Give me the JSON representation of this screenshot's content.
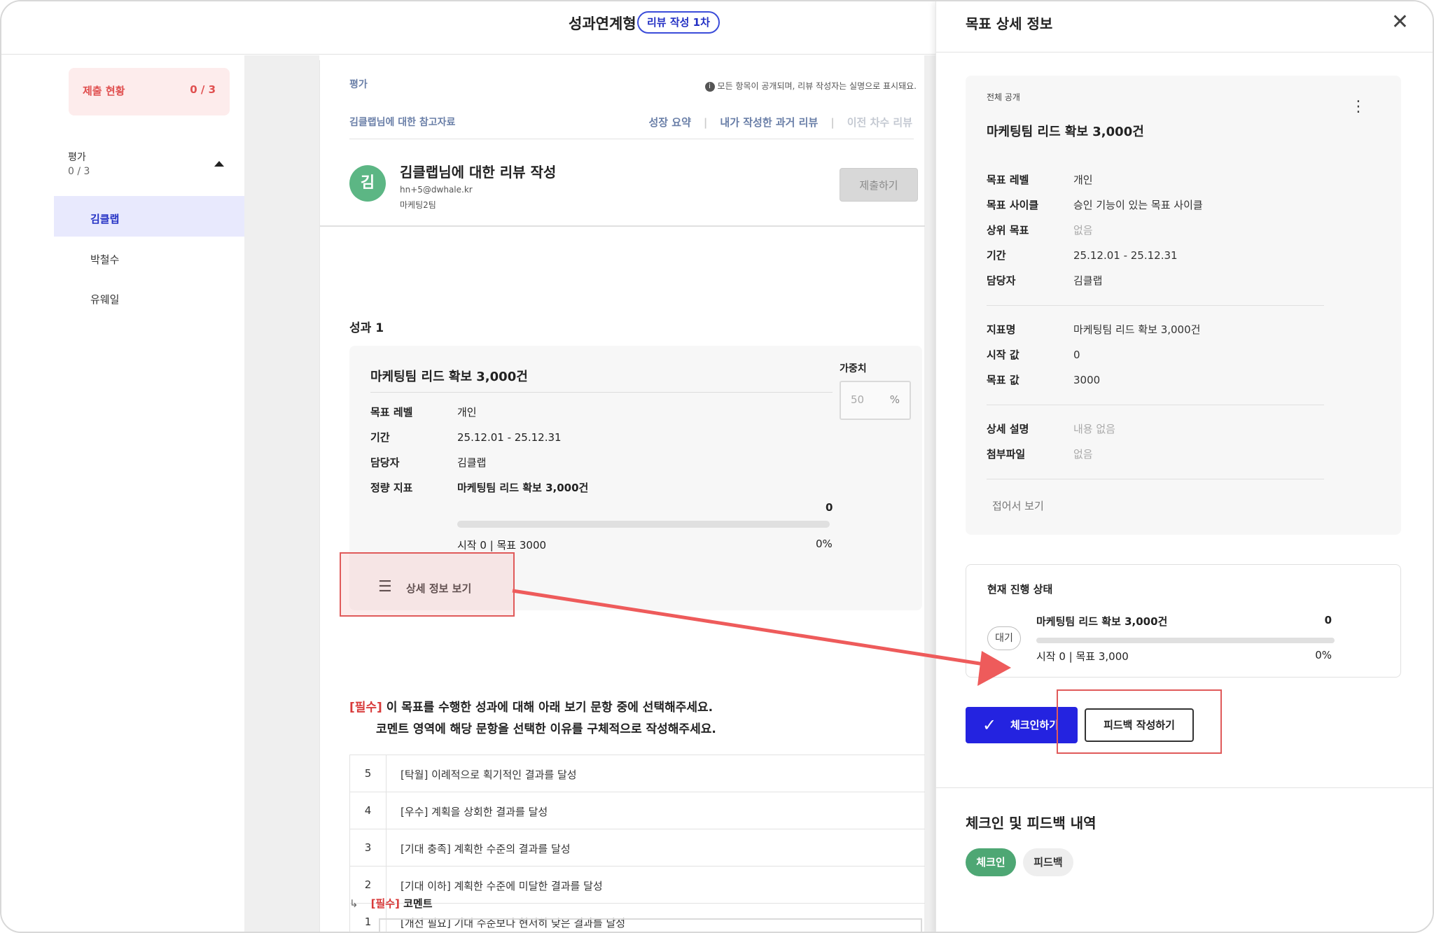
{
  "header": {
    "title": "성과연계형",
    "badge": "리뷰 작성 1차"
  },
  "sidebar": {
    "submission_label": "제출 현황",
    "submission_count": "0 / 3",
    "eval_label": "평가",
    "eval_count": "0 / 3",
    "people": [
      "김클랩",
      "박철수",
      "유웨일"
    ]
  },
  "main": {
    "eval_label": "평가",
    "notice": "모든 항목이 공개되며, 리뷰 작성자는 실명으로 표시돼요.",
    "reference_label": "김클랩님에 대한 참고자료",
    "tabs": [
      "성장 요약",
      "내가 작성한 과거 리뷰",
      "이전 차수 리뷰"
    ],
    "avatar_initial": "김",
    "review_title": "김클랩님에 대한 리뷰 작성",
    "email": "hn+5@dwhale.kr",
    "team": "마케팅2팀",
    "submit_label": "제출하기",
    "section_title": "성과 1",
    "goal": {
      "name": "마케팅팀 리드 확보 3,000건",
      "level_label": "목표 레벨",
      "level": "개인",
      "period_label": "기간",
      "period": "25.12.01 - 25.12.31",
      "owner_label": "담당자",
      "owner": "김클랩",
      "metric_label": "정량 지표",
      "metric": "마케팅팀 리드 확보 3,000건",
      "current": "0",
      "range": "시작 0 | 목표 3000",
      "percent": "0%",
      "progress": 0
    },
    "weight_label": "가중치",
    "weight_value": "50",
    "weight_unit": "%",
    "detail_button": "상세 정보 보기",
    "required_tag": "[필수]",
    "question_line1": " 이 목표를 수행한 성과에 대해 아래 보기 문항 중에 선택해주세요.",
    "question_line2": "코멘트 영역에 해당 문항을 선택한 이유를 구체적으로 작성해주세요.",
    "options": [
      {
        "n": "5",
        "text": "[탁월] 이례적으로 획기적인 결과를 달성"
      },
      {
        "n": "4",
        "text": "[우수] 계획을 상회한 결과를 달성"
      },
      {
        "n": "3",
        "text": "[기대 충족] 계획한 수준의 결과를 달성"
      },
      {
        "n": "2",
        "text": "[기대 이하] 계획한 수준에 미달한 결과를 달성"
      },
      {
        "n": "1",
        "text": "[개선 필요] 기대 수준보다 현저히 낮은 결과를 달성"
      }
    ],
    "comment_label": "코멘트"
  },
  "panel": {
    "title": "목표 상세 정보",
    "visibility": "전체 공개",
    "goal_name": "마케팅팀 리드 확보 3,000건",
    "rows1": [
      {
        "k": "목표 레벨",
        "v": "개인"
      },
      {
        "k": "목표 사이클",
        "v": "승인 기능이 있는 목표 사이클"
      },
      {
        "k": "상위 목표",
        "v": "없음"
      },
      {
        "k": "기간",
        "v": "25.12.01 - 25.12.31"
      },
      {
        "k": "담당자",
        "v": "김클랩"
      }
    ],
    "rows2": [
      {
        "k": "지표명",
        "v": "마케팅팀 리드 확보 3,000건"
      },
      {
        "k": "시작 값",
        "v": "0"
      },
      {
        "k": "목표 값",
        "v": "3000"
      }
    ],
    "rows3": [
      {
        "k": "상세 설명",
        "v": "내용 없음"
      },
      {
        "k": "첨부파일",
        "v": "없음"
      }
    ],
    "fold_label": "접어서 보기",
    "status_title": "현재 진행 상태",
    "status_badge": "대기",
    "status_goal": "마케팅팀 리드 확보 3,000건",
    "status_current": "0",
    "status_range": "시작 0 | 목표 3,000",
    "status_percent": "0%",
    "checkin_button": "체크인하기",
    "feedback_button": "피드백 작성하기",
    "history_title": "체크인 및 피드백 내역",
    "chip_checkin": "체크인",
    "chip_feedback": "피드백"
  },
  "colors": {
    "accent": "#2423e0",
    "danger": "#d83a3a",
    "success": "#4ea774",
    "highlight": "#e05a5a"
  }
}
